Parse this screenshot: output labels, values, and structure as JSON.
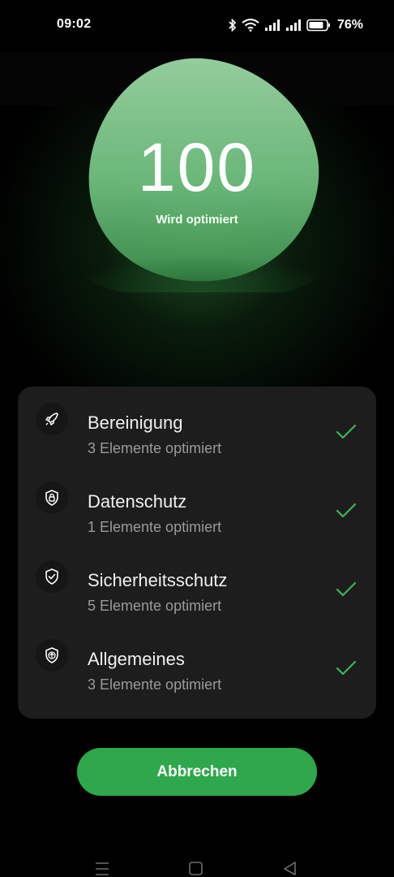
{
  "status_bar": {
    "time": "09:02",
    "battery_percent": "76%",
    "icons": [
      "bluetooth-icon",
      "wifi-icon",
      "signal-icon",
      "signal-icon",
      "battery-icon"
    ]
  },
  "score": {
    "value": "100",
    "subtitle": "Wird optimiert"
  },
  "items": [
    {
      "title": "Bereinigung",
      "subtitle": "3 Elemente optimiert",
      "icon": "rocket-icon",
      "status": "check-icon"
    },
    {
      "title": "Datenschutz",
      "subtitle": "1 Elemente optimiert",
      "icon": "privacy-lock-shield-icon",
      "status": "check-icon"
    },
    {
      "title": "Sicherheitsschutz",
      "subtitle": "5 Elemente optimiert",
      "icon": "check-shield-icon",
      "status": "check-icon"
    },
    {
      "title": "Allgemeines",
      "subtitle": "3 Elemente optimiert",
      "icon": "upload-shield-icon",
      "status": "check-icon"
    }
  ],
  "cancel_button": "Abbrechen",
  "navigation": [
    "menu-icon",
    "home-icon",
    "back-icon"
  ],
  "colors": {
    "accent": "#2ea84a",
    "check": "#3cb55a",
    "card": "#1d1d1d",
    "blob": "#7cc68a"
  }
}
